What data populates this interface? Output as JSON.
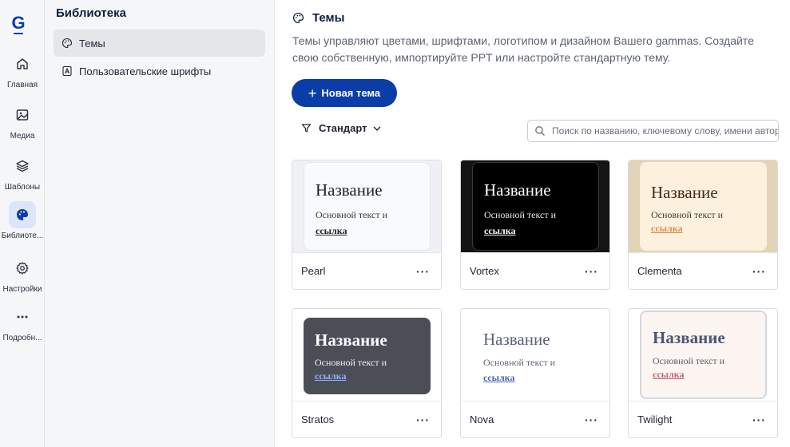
{
  "rail": {
    "items": [
      {
        "label": "Главная",
        "icon": "home-icon"
      },
      {
        "label": "Медиа",
        "icon": "image-icon"
      },
      {
        "label": "Шаблоны",
        "icon": "layers-icon"
      },
      {
        "label": "Библиоте...",
        "icon": "palette-icon",
        "active": true
      },
      {
        "label": "Настройки",
        "icon": "gear-icon"
      },
      {
        "label": "Подробн...",
        "icon": "more-icon"
      }
    ]
  },
  "library": {
    "title": "Библиотека",
    "items": [
      {
        "label": "Темы",
        "icon": "palette-icon",
        "active": true
      },
      {
        "label": "Пользовательские шрифты",
        "icon": "font-icon"
      }
    ]
  },
  "main": {
    "title": "Темы",
    "description": "Темы управляют цветами, шрифтами, логотипом и дизайном Вашего gammas. Создайте свою собственную, импортируйте PPT или настройте стандартную тему.",
    "new_button": "Новая тема",
    "filter_label": "Стандарт",
    "search_placeholder": "Поиск по названию, ключевому слову, имени автора",
    "more_label": "···",
    "themes": [
      {
        "name": "Pearl",
        "title": "Название",
        "body": "Основной текст и",
        "link": "ссылка"
      },
      {
        "name": "Vortex",
        "title": "Название",
        "body": "Основной текст и",
        "link": "ссылка"
      },
      {
        "name": "Clementa",
        "title": "Название",
        "body": "Основной текст и",
        "link": "ссылка"
      },
      {
        "name": "Stratos",
        "title": "Название",
        "body": "Основной текст и",
        "link": "ссылка"
      },
      {
        "name": "Nova",
        "title": "Название",
        "body": "Основной текст и",
        "link": "ссылка"
      },
      {
        "name": "Twilight",
        "title": "Название",
        "body": "Основной текст и",
        "link": "ссылка"
      }
    ]
  },
  "colors": {
    "accent": "#0a3da8",
    "active_rail": "#dbe6fb",
    "panel_bg": "#f5f6f8"
  }
}
